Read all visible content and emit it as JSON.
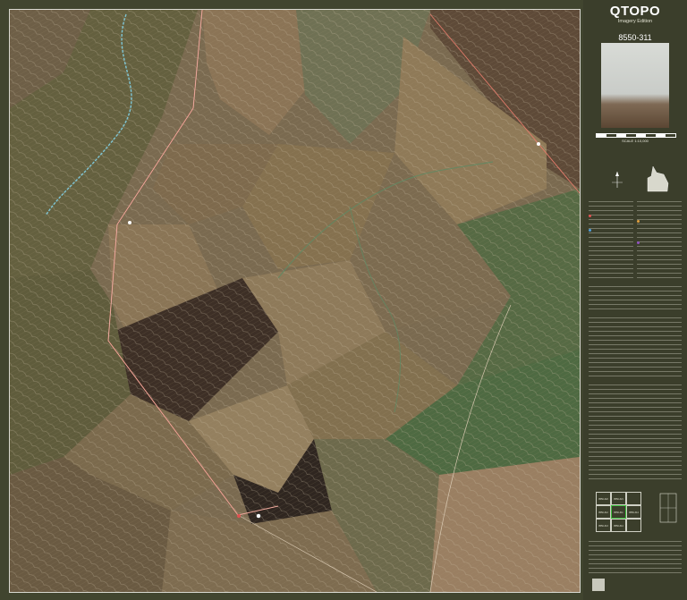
{
  "panel": {
    "title": "QTOPO",
    "edition": "Imagery Edition",
    "sheet_number": "8550-311",
    "scale": "SCALE 1:10,000"
  },
  "index_map": {
    "cells": [
      "8550-322",
      "8550-321",
      "",
      "8550-312",
      "8550-311",
      "8550-314",
      "8550-313",
      "8550-314",
      ""
    ]
  },
  "colors": {
    "panel_bg": "#3b3e2b",
    "road": "#e07a6a",
    "waterway": "#7fc6d6",
    "accent_highlight": "#2f8a2f"
  },
  "icons": [
    "north-arrow-icon",
    "queensland-outline-icon",
    "homestead-marker-icon",
    "coat-of-arms-icon"
  ]
}
